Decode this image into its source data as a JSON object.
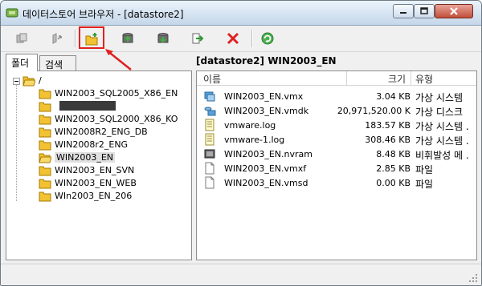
{
  "window": {
    "title": "데이터스토어 브라우저 - [datastore2]"
  },
  "toolbar": {
    "buttons": [
      {
        "name": "browse-icon"
      },
      {
        "name": "upload-icon"
      },
      {
        "name": "new-folder-icon"
      },
      {
        "name": "upload-file-icon"
      },
      {
        "name": "download-icon"
      },
      {
        "name": "move-icon"
      },
      {
        "name": "delete-icon"
      },
      {
        "name": "refresh-icon"
      }
    ]
  },
  "left": {
    "tabs": [
      "폴더",
      "검색"
    ],
    "root": "/",
    "folders": [
      "WIN2003_SQL2005_X86_EN",
      "",
      "WIN2003_SQL2000_X86_KO",
      "WIN2008R2_ENG_DB",
      "WIN2008r2_ENG",
      "WIN2003_EN",
      "WIN2003_EN_SVN",
      "WIN2003_EN_WEB",
      "WIn2003_EN_206"
    ]
  },
  "right": {
    "path": "[datastore2] WIN2003_EN",
    "columns": [
      "이름",
      "크기",
      "유형"
    ],
    "files": [
      {
        "name": "WIN2003_EN.vmx",
        "size": "3.04 KB",
        "type": "가상 시스템",
        "icon": "vmx-icon"
      },
      {
        "name": "WIN2003_EN.vmdk",
        "size": "20,971,520.00 K",
        "type": "가상 디스크",
        "icon": "vmdk-icon"
      },
      {
        "name": "vmware.log",
        "size": "183.57 KB",
        "type": "가상 시스템 .",
        "icon": "log-icon"
      },
      {
        "name": "vmware-1.log",
        "size": "308.46 KB",
        "type": "가상 시스템 .",
        "icon": "log-icon"
      },
      {
        "name": "WIN2003_EN.nvram",
        "size": "8.48 KB",
        "type": "비휘발성 메 .",
        "icon": "nvram-icon"
      },
      {
        "name": "WIN2003_EN.vmxf",
        "size": "2.85 KB",
        "type": "파일",
        "icon": "file-icon"
      },
      {
        "name": "WIN2003_EN.vmsd",
        "size": "0.00 KB",
        "type": "파일",
        "icon": "file-icon"
      }
    ]
  }
}
